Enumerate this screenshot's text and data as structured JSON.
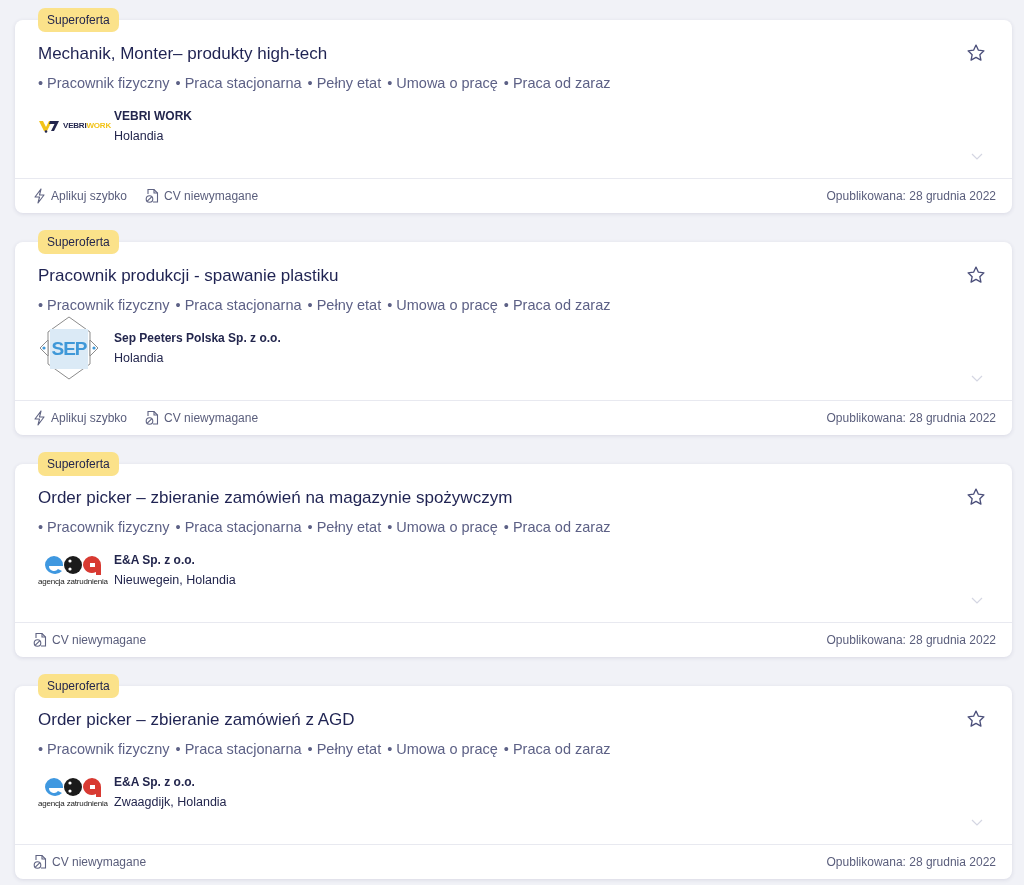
{
  "offers": [
    {
      "badge": "Superoferta",
      "title": "Mechanik, Monter– produkty high-tech",
      "saved": false,
      "tags": [
        "• Pracownik fizyczny",
        "• Praca stacjonarna",
        "• Pełny etat",
        "• Umowa o pracę",
        "• Praca od zaraz"
      ],
      "company": "VEBRI WORK",
      "location": "Holandia",
      "logo": {
        "kind": "vebri",
        "parts": [
          "VEBRI",
          "WORK"
        ]
      },
      "features": [
        {
          "kind": "quick_apply",
          "label": "Aplikuj szybko"
        },
        {
          "kind": "no_cv",
          "label": "CV niewymagane"
        }
      ],
      "published": "Opublikowana: 28 grudnia 2022"
    },
    {
      "badge": "Superoferta",
      "title": "Pracownik produkcji - spawanie plastiku",
      "saved": false,
      "tags": [
        "• Pracownik fizyczny",
        "• Praca stacjonarna",
        "• Pełny etat",
        "• Umowa o pracę",
        "• Praca od zaraz"
      ],
      "company": "Sep Peeters Polska Sp. z o.o.",
      "location": "Holandia",
      "logo": {
        "kind": "sep",
        "text": "SEP"
      },
      "features": [
        {
          "kind": "quick_apply",
          "label": "Aplikuj szybko"
        },
        {
          "kind": "no_cv",
          "label": "CV niewymagane"
        }
      ],
      "published": "Opublikowana: 28 grudnia 2022"
    },
    {
      "badge": "Superoferta",
      "title": "Order picker – zbieranie zamówień na magazynie spożywczym",
      "saved": false,
      "tags": [
        "• Pracownik fizyczny",
        "• Praca stacjonarna",
        "• Pełny etat",
        "• Umowa o pracę",
        "• Praca od zaraz"
      ],
      "company": "E&A Sp. z o.o.",
      "location": "Nieuwegein, Holandia",
      "logo": {
        "kind": "ea",
        "caption": "agencja zatrudnienia"
      },
      "features": [
        {
          "kind": "no_cv",
          "label": "CV niewymagane"
        }
      ],
      "published": "Opublikowana: 28 grudnia 2022"
    },
    {
      "badge": "Superoferta",
      "title": "Order picker – zbieranie zamówień z AGD",
      "saved": false,
      "tags": [
        "• Pracownik fizyczny",
        "• Praca stacjonarna",
        "• Pełny etat",
        "• Umowa o pracę",
        "• Praca od zaraz"
      ],
      "company": "E&A Sp. z o.o.",
      "location": "Zwaagdijk, Holandia",
      "logo": {
        "kind": "ea",
        "caption": "agencja zatrudnienia"
      },
      "features": [
        {
          "kind": "no_cv",
          "label": "CV niewymagane"
        }
      ],
      "published": "Opublikowana: 28 grudnia 2022"
    }
  ]
}
